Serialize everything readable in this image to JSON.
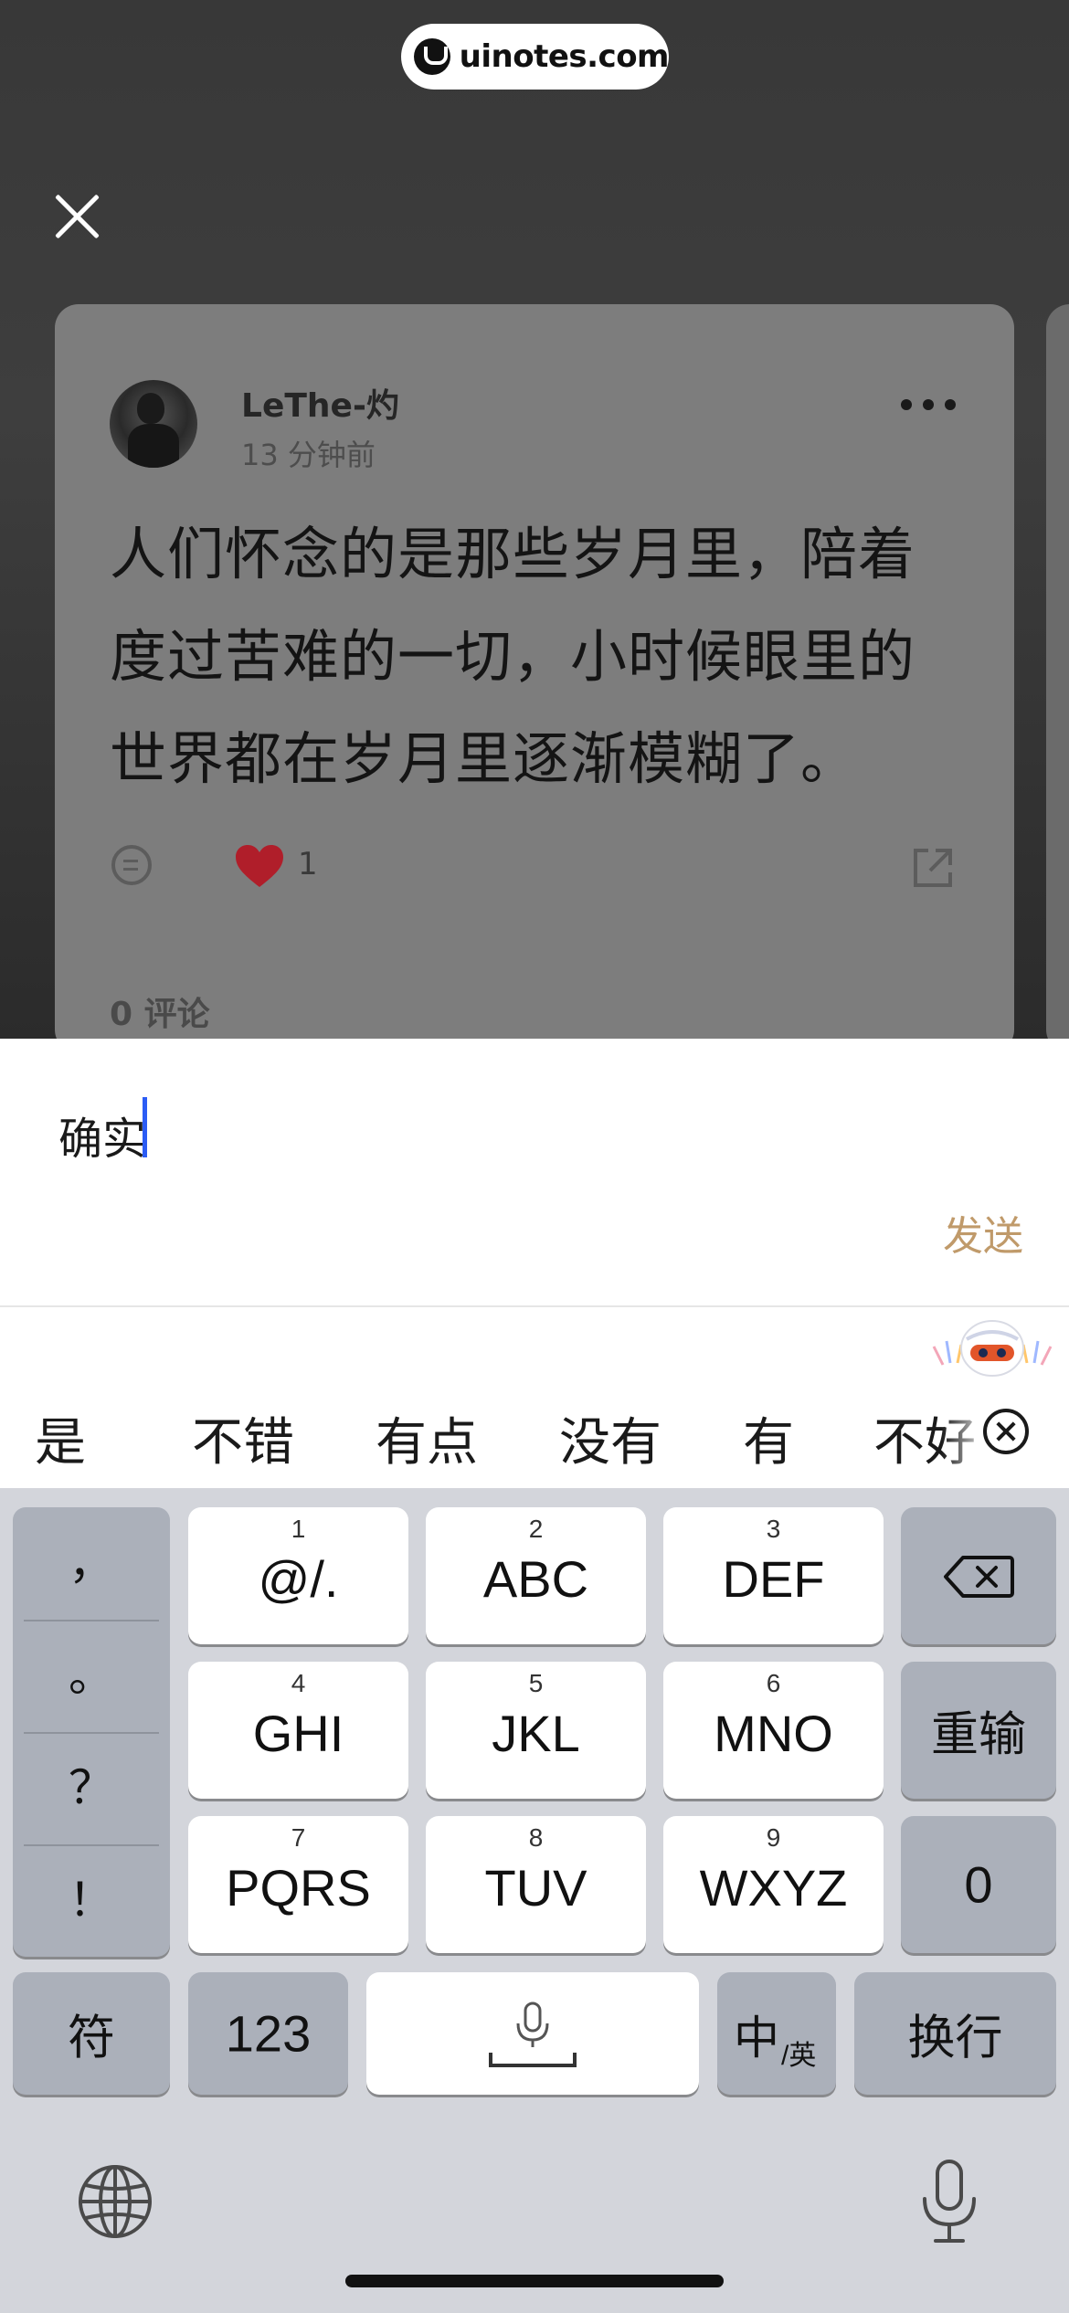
{
  "watermark": {
    "text": "uinotes.com"
  },
  "post": {
    "username": "LeThe-灼",
    "time": "13 分钟前",
    "lines": [
      "人们怀念的是那些岁月里，陪着",
      "度过苦难的一切，小时候眼里的",
      "世界都在岁月里逐渐模糊了。"
    ],
    "likes": "1",
    "comments": "0 评论"
  },
  "composer": {
    "text": "确实",
    "send": "发送"
  },
  "candidates": [
    "是",
    "不错",
    "有点",
    "没有",
    "有",
    "不好"
  ],
  "keyboard": {
    "punct": [
      "，",
      "。",
      "？",
      "！"
    ],
    "rows": [
      [
        {
          "num": "1",
          "label": "@/."
        },
        {
          "num": "2",
          "label": "ABC"
        },
        {
          "num": "3",
          "label": "DEF"
        }
      ],
      [
        {
          "num": "4",
          "label": "GHI"
        },
        {
          "num": "5",
          "label": "JKL"
        },
        {
          "num": "6",
          "label": "MNO"
        }
      ],
      [
        {
          "num": "7",
          "label": "PQRS"
        },
        {
          "num": "8",
          "label": "TUV"
        },
        {
          "num": "9",
          "label": "WXYZ"
        }
      ]
    ],
    "reenter": "重输",
    "zero": "0",
    "symbols": "符",
    "numbers": "123",
    "lang_main": "中",
    "lang_sub": "/英",
    "return": "换行"
  },
  "colors": {
    "accent": "#c09a6a",
    "caret": "#2b5cf5",
    "heart": "#b01e2a"
  },
  "icons": [
    "close-icon",
    "more-icon",
    "comment-icon",
    "heart-icon",
    "share-icon",
    "backspace-icon",
    "mic-icon",
    "globe-icon",
    "dismiss-candidates-icon"
  ]
}
